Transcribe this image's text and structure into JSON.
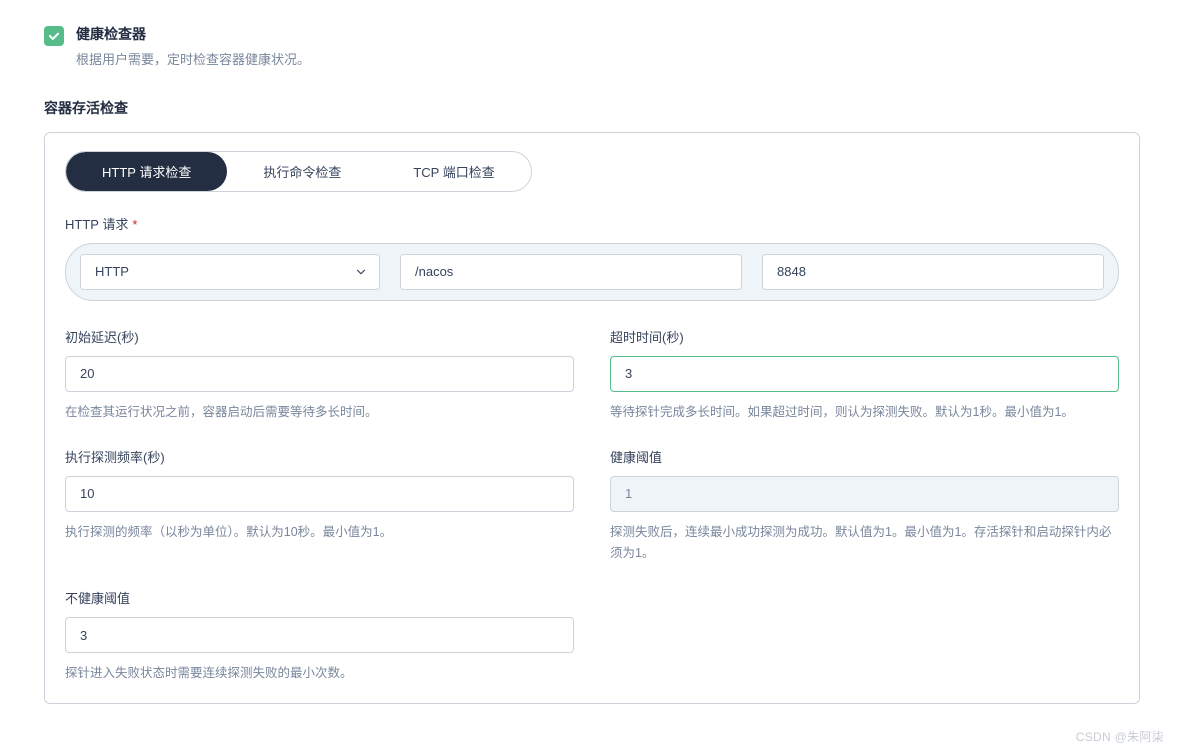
{
  "header": {
    "title": "健康检查器",
    "desc": "根据用户需要，定时检查容器健康状况。"
  },
  "group": {
    "title": "容器存活检查"
  },
  "tabs": [
    {
      "label": "HTTP 请求检查",
      "active": true
    },
    {
      "label": "执行命令检查",
      "active": false
    },
    {
      "label": "TCP 端口检查",
      "active": false
    }
  ],
  "request": {
    "label": "HTTP 请求",
    "protocol": "HTTP",
    "path": "/nacos",
    "port": "8848"
  },
  "fields": {
    "initialDelay": {
      "label": "初始延迟(秒)",
      "value": "20",
      "help": "在检查其运行状况之前，容器启动后需要等待多长时间。"
    },
    "timeout": {
      "label": "超时时间(秒)",
      "value": "3",
      "help": "等待探针完成多长时间。如果超过时间，则认为探测失败。默认为1秒。最小值为1。"
    },
    "period": {
      "label": "执行探测频率(秒)",
      "value": "10",
      "help": "执行探测的频率（以秒为单位）。默认为10秒。最小值为1。"
    },
    "successThreshold": {
      "label": "健康阈值",
      "value": "1",
      "help": "探测失败后，连续最小成功探测为成功。默认值为1。最小值为1。存活探针和启动探针内必须为1。"
    },
    "failureThreshold": {
      "label": "不健康阈值",
      "value": "3",
      "help": "探针进入失败状态时需要连续探测失败的最小次数。"
    }
  },
  "watermark": "CSDN @朱阿柒"
}
